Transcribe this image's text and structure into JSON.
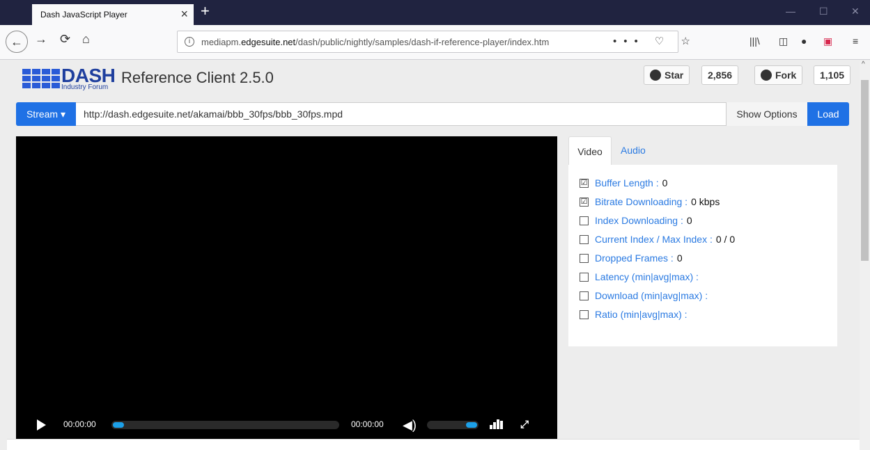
{
  "browser": {
    "tab_title": "Dash JavaScript Player",
    "tab_close": "×",
    "new_tab": "+",
    "minimize": "—",
    "maximize": "☐",
    "close": "✕",
    "url_prefix": "mediapm.",
    "url_host": "edgesuite.net",
    "url_path": "/dash/public/nightly/samples/dash-if-reference-player/index.htm",
    "url_actions": "••• ♡ ☆"
  },
  "header": {
    "logo_main": "DASH",
    "logo_sub": "Industry Forum",
    "title": "Reference Client 2.5.0",
    "star_label": "Star",
    "star_count": "2,856",
    "fork_label": "Fork",
    "fork_count": "1,105"
  },
  "stream": {
    "button_label": "Stream ▾",
    "url": "http://dash.edgesuite.net/akamai/bbb_30fps/bbb_30fps.mpd",
    "show_options_label": "Show Options",
    "load_label": "Load"
  },
  "player": {
    "current_time": "00:00:00",
    "duration": "00:00:00",
    "volume_icon": "🔊",
    "fullscreen_icon": "⛶",
    "seek_progress": 0.0,
    "volume_level": 1.0
  },
  "stats": {
    "tabs": [
      {
        "label": "Video"
      },
      {
        "label": "Audio"
      }
    ],
    "items": [
      {
        "checked": "☑",
        "label": "Buffer Length :",
        "value": "0"
      },
      {
        "checked": "☑",
        "label": "Bitrate Downloading :",
        "value": "0 kbps"
      },
      {
        "checked": "",
        "label": "Index Downloading :",
        "value": "0"
      },
      {
        "checked": "",
        "label": "Current Index / Max Index :",
        "value": "0 / 0"
      },
      {
        "checked": "",
        "label": "Dropped Frames :",
        "value": "0"
      },
      {
        "checked": "",
        "label": "Latency (min|avg|max) :",
        "value": ""
      },
      {
        "checked": "",
        "label": "Download (min|avg|max) :",
        "value": ""
      },
      {
        "checked": "",
        "label": "Ratio (min|avg|max) :",
        "value": ""
      }
    ]
  }
}
